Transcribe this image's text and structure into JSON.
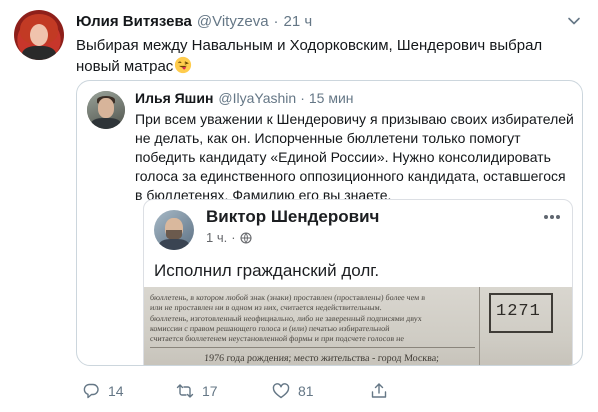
{
  "tweet": {
    "author_name": "Юлия Витязева",
    "handle": "@Vityzeva",
    "separator": "·",
    "time": "21 ч",
    "text": "Выбирая между Навальным и Ходорковским, Шендерович выбрал новый матрас",
    "emoji": "face-with-tongue-and-winking-eye"
  },
  "quoted": {
    "author_name": "Илья Яшин",
    "handle": "@IlyaYashin",
    "separator": "·",
    "time": "15 мин",
    "text": "При всем уважении к Шендеровичу я призываю своих избирателей не делать, как он. Испорченные бюллетени только помогут победить кандидату «Единой России». Нужно консолидировать голоса за единственного оппозиционного кандидата, оставшегося в бюллетенях. Фамилию его вы знаете."
  },
  "facebook_post": {
    "author_name": "Виктор Шендерович",
    "time": "1 ч.",
    "separator": "·",
    "text": "Исполнил гражданский долг.",
    "ballot": {
      "box_number": "1271",
      "lines": [
        "бюллетень, в котором любой знак (знаки) проставлен (проставлены) более чем в",
        "или не проставлен ни в одном из них, считается недействительным.",
        "бюллетень, изготовленный неофициально, либо не заверенный подписями двух",
        "комиссии с правом решающего голоса и (или) печатью избирательной",
        "считается бюллетенем неустановленной формы и при подсчете голосов не",
        "1976 года рождения; место жительства - город Москва;"
      ]
    }
  },
  "actions": {
    "replies": "14",
    "retweets": "17",
    "likes": "81"
  },
  "colors": {
    "text": "#14171a",
    "secondary": "#657786",
    "border": "#ccd6dd"
  }
}
